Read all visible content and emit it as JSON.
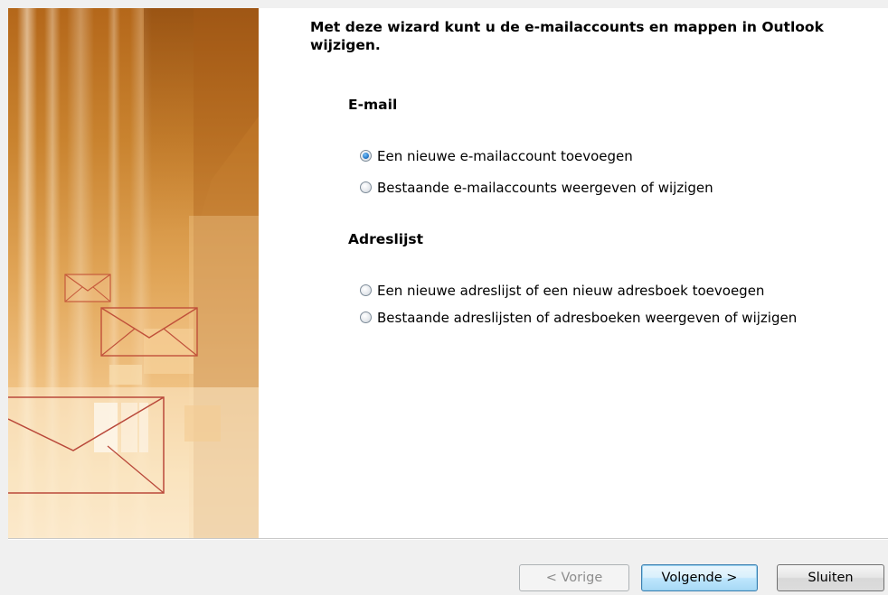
{
  "wizard": {
    "heading": "Met deze wizard kunt u de e-mailaccounts en mappen in Outlook wijzigen."
  },
  "sections": {
    "email": {
      "title": "E-mail",
      "options": [
        {
          "label": "Een nieuwe e-mailaccount toevoegen",
          "selected": true
        },
        {
          "label": "Bestaande e-mailaccounts weergeven of wijzigen",
          "selected": false
        }
      ]
    },
    "address": {
      "title": "Adreslijst",
      "options": [
        {
          "label": "Een nieuwe adreslijst of een nieuw adresboek toevoegen",
          "selected": false
        },
        {
          "label": "Bestaande adreslijsten of adresboeken weergeven of wijzigen",
          "selected": false
        }
      ]
    }
  },
  "buttons": {
    "back": "< Vorige",
    "next": "Volgende >",
    "close": "Sluiten"
  },
  "colors": {
    "banner_dark": "#b4671a",
    "banner_light": "#fbead0",
    "envelope_line": "#c0503a",
    "radio_selected": "#2a7fd0",
    "default_button_border": "#3c7fb1"
  },
  "icons": [
    "envelope-icon",
    "radio-selected",
    "radio-unselected"
  ]
}
